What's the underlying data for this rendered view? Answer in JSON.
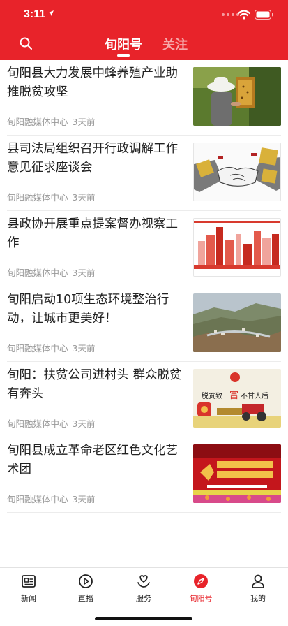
{
  "status_bar": {
    "time": "3:11"
  },
  "header": {
    "tabs": [
      {
        "label": "旬阳号",
        "active": true
      },
      {
        "label": "关注",
        "active": false
      }
    ]
  },
  "news": [
    {
      "title": "旬阳县大力发展中蜂养殖产业助推脱贫攻坚",
      "source": "旬阳融媒体中心",
      "time": "3天前",
      "thumb": "beekeeper"
    },
    {
      "title": "县司法局组织召开行政调解工作意见征求座谈会",
      "source": "旬阳融媒体中心",
      "time": "3天前",
      "thumb": "handshake"
    },
    {
      "title": "县政协开展重点提案督办视察工作",
      "source": "旬阳融媒体中心",
      "time": "3天前",
      "thumb": "city-skyline"
    },
    {
      "title": "旬阳启动10项生态环境整治行动，让城市更美好！",
      "source": "旬阳融媒体中心",
      "time": "3天前",
      "thumb": "landscape"
    },
    {
      "title": "旬阳：扶贫公司进村头 群众脱贫有奔头",
      "source": "旬阳融媒体中心",
      "time": "3天前",
      "thumb": "poverty-poster",
      "thumb_text": [
        "脱贫致",
        "富",
        "不甘人后"
      ]
    },
    {
      "title": "旬阳县成立革命老区红色文化艺术团",
      "source": "旬阳融媒体中心",
      "time": "3天前",
      "thumb": "red-stage"
    }
  ],
  "tabbar": [
    {
      "label": "新闻",
      "icon": "newspaper-icon",
      "active": false
    },
    {
      "label": "直播",
      "icon": "play-circle-icon",
      "active": false
    },
    {
      "label": "服务",
      "icon": "heart-hand-icon",
      "active": false
    },
    {
      "label": "旬阳号",
      "icon": "compass-icon",
      "active": true
    },
    {
      "label": "我的",
      "icon": "person-icon",
      "active": false
    }
  ],
  "colors": {
    "brand_red": "#e8232a",
    "meta_gray": "#999999"
  }
}
